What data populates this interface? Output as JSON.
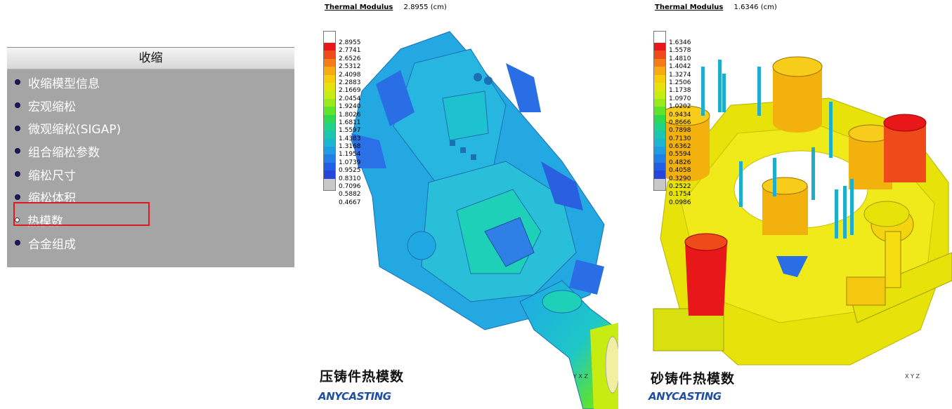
{
  "menu": {
    "header": "收缩",
    "items": [
      {
        "label": "收缩模型信息",
        "selected": false
      },
      {
        "label": "宏观缩松",
        "selected": false
      },
      {
        "label": "微观缩松(SIGAP)",
        "selected": false
      },
      {
        "label": "组合缩松参数",
        "selected": false
      },
      {
        "label": "缩松尺寸",
        "selected": false
      },
      {
        "label": "缩松体积",
        "selected": false
      },
      {
        "label": "热模数",
        "selected": true
      },
      {
        "label": "合金组成",
        "selected": false
      }
    ]
  },
  "left_view": {
    "quantity": "Thermal Modulus",
    "max_value": "2.8955 (cm)",
    "legend": [
      "2.8955",
      "2.7741",
      "2.6526",
      "2.5312",
      "2.4098",
      "2.2883",
      "2.1669",
      "2.0454",
      "1.9240",
      "1.8026",
      "1.6811",
      "1.5597",
      "1.4383",
      "1.3168",
      "1.1954",
      "1.0739",
      "0.9525",
      "0.8310",
      "0.7096",
      "0.5882",
      "0.4667"
    ],
    "caption": "压铸件热模数",
    "logo": "ANYCASTING",
    "axes": "Y X Z"
  },
  "right_view": {
    "quantity": "Thermal Modulus",
    "max_value": "1.6346 (cm)",
    "legend": [
      "1.6346",
      "1.5578",
      "1.4810",
      "1.4042",
      "1.3274",
      "1.2506",
      "1.1738",
      "1.0970",
      "1.0202",
      "0.9434",
      "0.8666",
      "0.7898",
      "0.7130",
      "0.6362",
      "0.5594",
      "0.4826",
      "0.4058",
      "0.3290",
      "0.2522",
      "0.1754",
      "0.0986"
    ],
    "caption": "砂铸件热模数",
    "logo": "ANYCASTING",
    "axes": "X Y Z"
  },
  "colors": {
    "scale": [
      "#ffffff",
      "#e8181a",
      "#ef4a1a",
      "#f47d17",
      "#f8aa12",
      "#f7cc0c",
      "#e6e20a",
      "#c7ec12",
      "#98ea1c",
      "#5fe42a",
      "#2ed950",
      "#1fd488",
      "#1cc7b2",
      "#1cb6d0",
      "#1e9ee0",
      "#217fe6",
      "#235ee6",
      "#2645dc",
      "#c8c8c8"
    ],
    "menu_bg": "#a5a5a5",
    "highlight": "#e0191f"
  }
}
